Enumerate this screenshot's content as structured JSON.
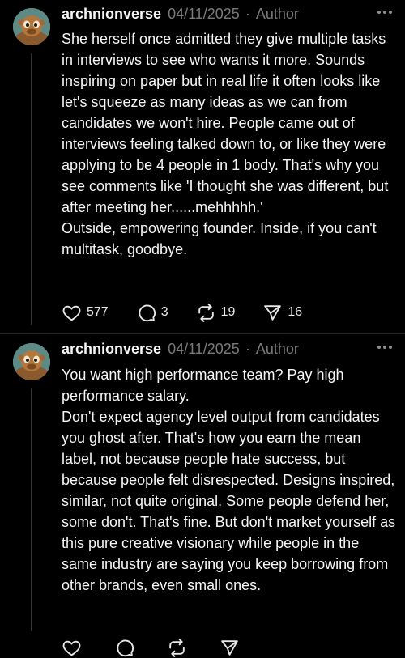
{
  "posts": [
    {
      "username": "archnionverse",
      "date": "04/11/2025",
      "separator": "·",
      "role": "Author",
      "paragraphs": [
        "She herself once admitted they give multiple tasks in interviews to see who wants it more. Sounds inspiring on paper but in real life it often looks like let's squeeze as many ideas as we can from candidates we won't hire. People came out of interviews feeling talked down to, or like they were applying to be 4 people in 1 body. That's why you see comments like 'I thought she was different, but after meeting her......mehhhhh.'",
        "Outside, empowering founder. Inside, if you can't multitask, goodbye."
      ],
      "likes": "577",
      "replies": "3",
      "reposts": "19",
      "shares": "16"
    },
    {
      "username": "archnionverse",
      "date": "04/11/2025",
      "separator": "·",
      "role": "Author",
      "paragraphs": [
        "You want high performance team? Pay high performance salary.",
        "Don't expect agency level output from candidates you ghost after. That's how you earn the mean label, not because people hate success, but because people felt disrespected. Designs inspired, similar, not quite original. Some people defend her, some don't. That's fine. But don't market yourself as this pure creative visionary while people in the same industry are saying you keep borrowing from other brands, even small ones."
      ]
    }
  ],
  "icons": {
    "like": "heart-icon",
    "reply": "comment-icon",
    "repost": "repost-icon",
    "share": "send-icon",
    "more": "more-icon"
  },
  "colors": {
    "background": "#000000",
    "text": "#f3f5f7",
    "muted": "#7a7a7a"
  }
}
